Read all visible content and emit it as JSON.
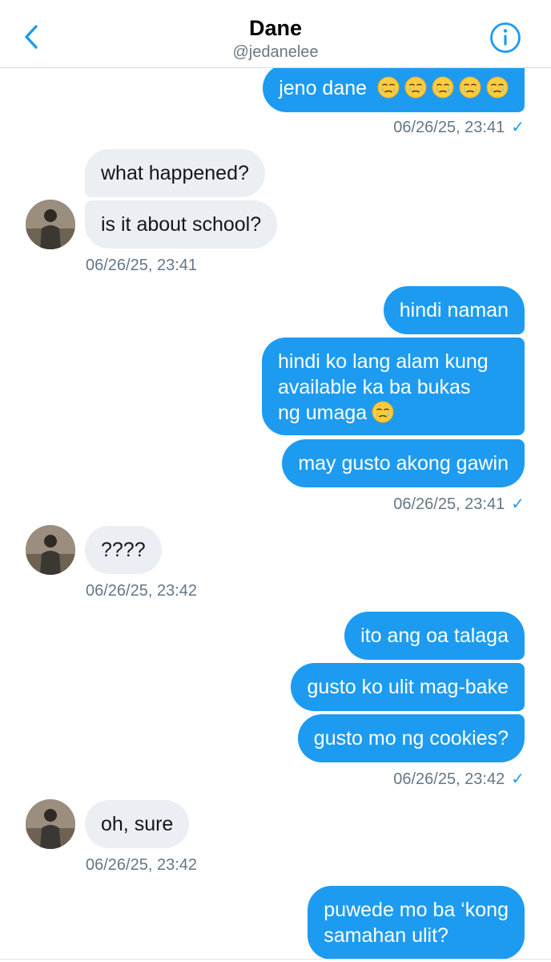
{
  "header": {
    "name": "Dane",
    "handle": "@jedanelee"
  },
  "messages": [
    {
      "dir": "out",
      "text": "jeno dane",
      "emoji_count": 5,
      "emoji": "face-holding-back-tears-emoji"
    },
    {
      "dir": "ts-out",
      "text": "06/26/25, 23:41",
      "check": "✓"
    },
    {
      "dir": "in",
      "text": "what happened?"
    },
    {
      "dir": "in",
      "text": "is it about school?"
    },
    {
      "dir": "ts-in",
      "text": "06/26/25, 23:41"
    },
    {
      "dir": "out",
      "text": "hindi naman"
    },
    {
      "dir": "out",
      "lines": [
        "hindi ko lang alam kung",
        "available ka ba bukas",
        "ng umaga"
      ],
      "emoji_count": 1,
      "emoji": "face-holding-back-tears-emoji"
    },
    {
      "dir": "out",
      "text": "may gusto akong gawin"
    },
    {
      "dir": "ts-out",
      "text": "06/26/25, 23:41",
      "check": "✓"
    },
    {
      "dir": "in",
      "text": "????"
    },
    {
      "dir": "ts-in",
      "text": "06/26/25, 23:42"
    },
    {
      "dir": "out",
      "text": "ito ang oa talaga"
    },
    {
      "dir": "out",
      "text": "gusto ko ulit mag-bake"
    },
    {
      "dir": "out",
      "text": "gusto mo ng cookies?"
    },
    {
      "dir": "ts-out",
      "text": "06/26/25, 23:42",
      "check": "✓"
    },
    {
      "dir": "in",
      "text": "oh, sure"
    },
    {
      "dir": "ts-in",
      "text": "06/26/25, 23:42"
    },
    {
      "dir": "out",
      "lines": [
        "puwede mo ba ‘kong",
        "samahan ulit?"
      ]
    }
  ],
  "colors": {
    "accent": "#1d9bf0",
    "incoming_bubble": "#ebeef2",
    "timestamp": "#657786"
  }
}
